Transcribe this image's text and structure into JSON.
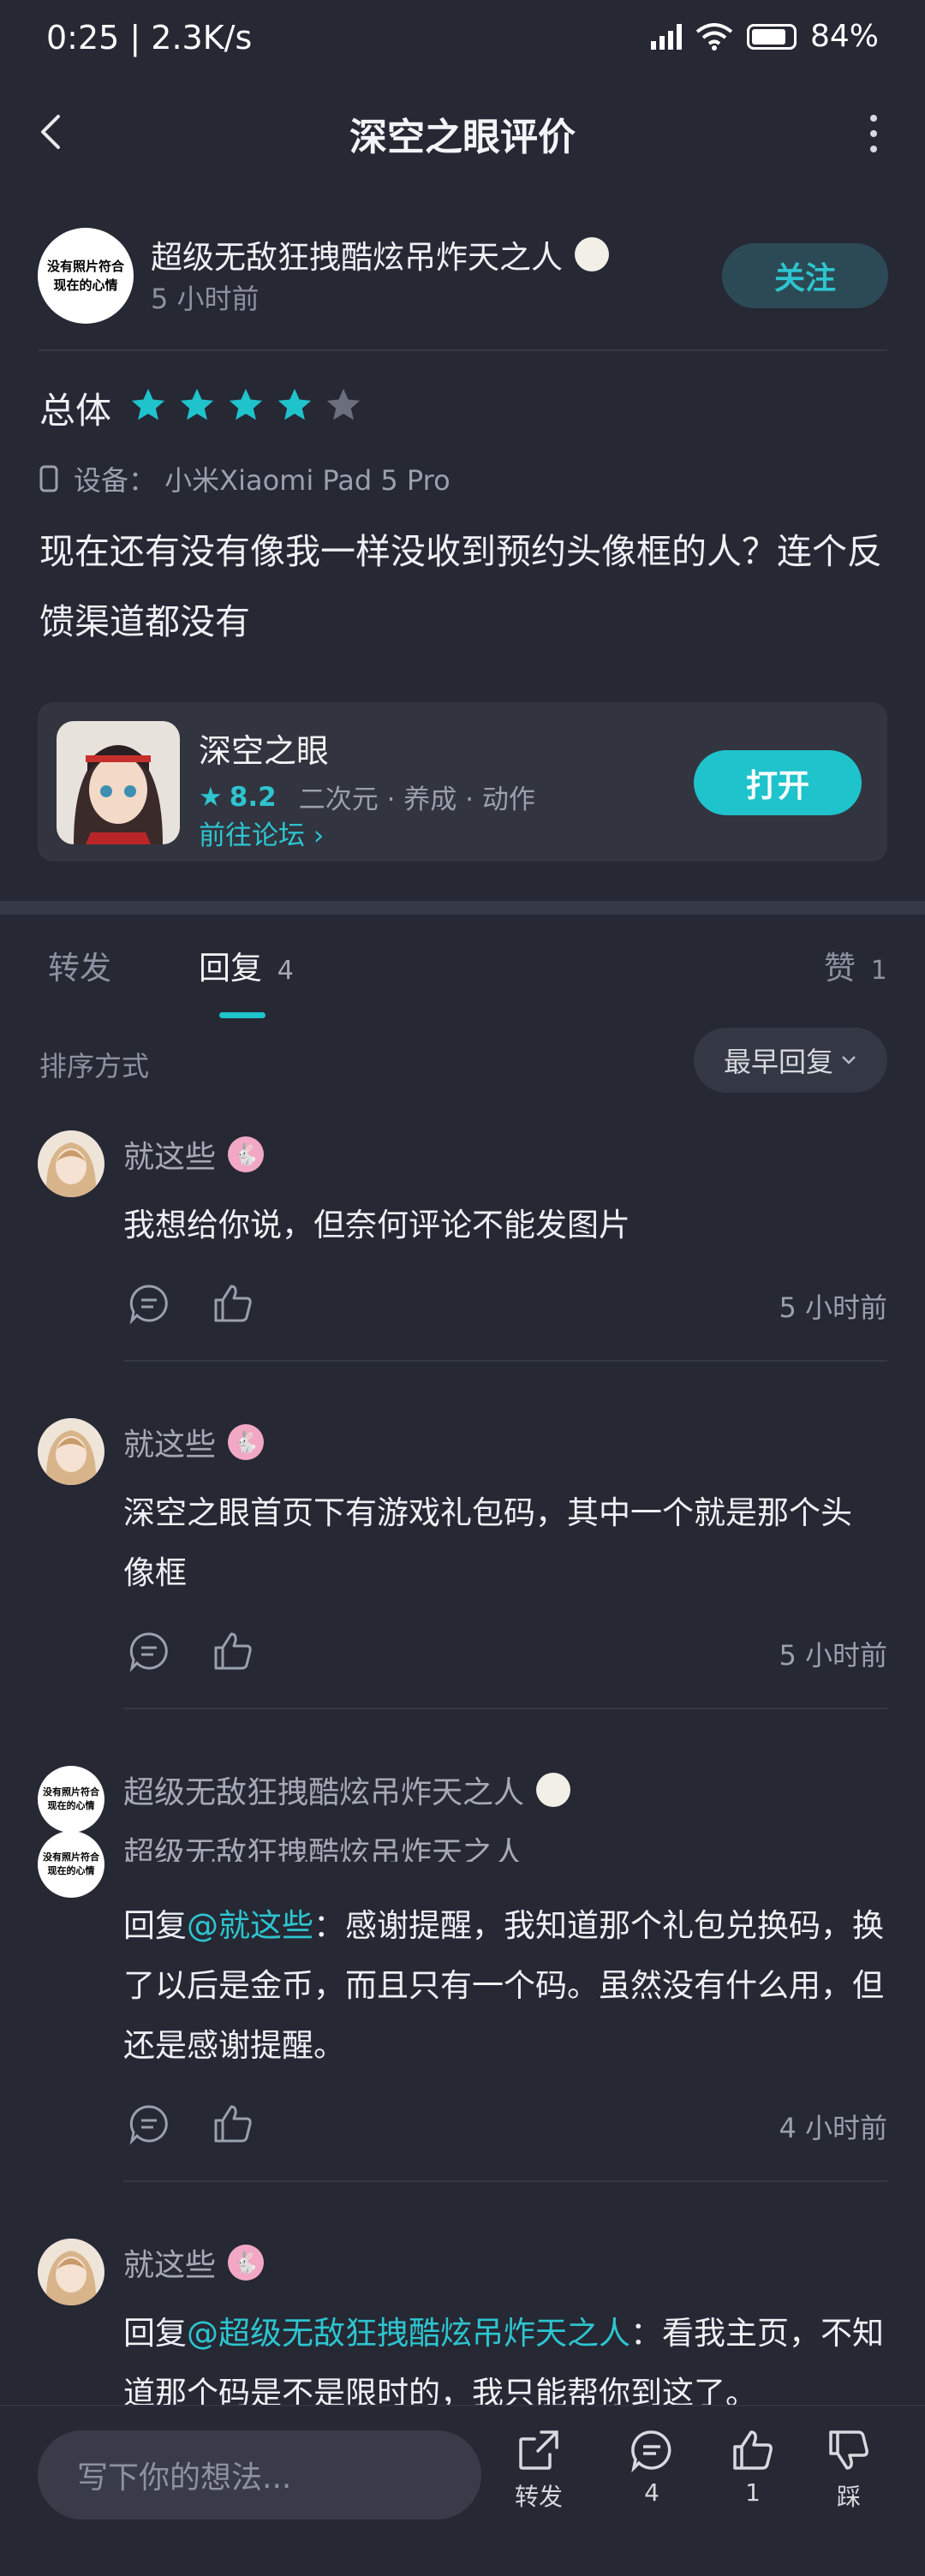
{
  "status_bar": {
    "time_speed": "0:25 | 2.3K/s",
    "battery": "84%"
  },
  "header": {
    "title": "深空之眼评价"
  },
  "author": {
    "avatar_text_line1": "没有照片符合",
    "avatar_text_line2": "现在的心情",
    "name": "超级无敌狂拽酷炫吊炸天之人",
    "time": "5 小时前",
    "follow_label": "关注"
  },
  "rating": {
    "label": "总体",
    "stars": 4,
    "max": 5
  },
  "device": {
    "text": "设备：  小米Xiaomi Pad 5 Pro"
  },
  "review": {
    "text": "现在还有没有像我一样没收到预约头像框的人？连个反馈渠道都没有"
  },
  "game": {
    "name": "深空之眼",
    "score": "8.2",
    "tags": "二次元 · 养成 · 动作",
    "forum_link": "前往论坛 ›",
    "open_label": "打开"
  },
  "tabs": {
    "repost": "转发",
    "reply": "回复",
    "reply_count": "4",
    "like": "赞",
    "like_count": "1"
  },
  "sort": {
    "label": "排序方式",
    "value": "最早回复"
  },
  "comments": [
    {
      "name": "就这些",
      "text": "我想给你说，但奈何评论不能发图片",
      "time": "5 小时前"
    },
    {
      "name": "就这些",
      "text": "深空之眼首页下有游戏礼包码，其中一个就是那个头像框",
      "time": "5 小时前"
    },
    {
      "name": "超级无敌狂拽酷炫吊炸天之人",
      "overlap_name": "超级无敌狂拽酷炫吊炸天之人",
      "reply_prefix": "回复",
      "reply_to": "@就这些",
      "text": "：感谢提醒，我知道那个礼包兑换码，换了以后是金币，而且只有一个码。虽然没有什么用，但还是感谢提醒。",
      "time": "4 小时前"
    },
    {
      "name": "就这些",
      "reply_prefix": "回复",
      "reply_to": "@超级无敌狂拽酷炫吊炸天之人",
      "text": "：看我主页，不知道那个码是不是限时的，我只能帮你到这了。"
    }
  ],
  "bottom_bar": {
    "input_placeholder": "写下你的想法...",
    "repost": "转发",
    "comments": "4",
    "likes": "1",
    "dislike": "踩"
  },
  "colors": {
    "background": "#262834",
    "accent": "#1fc3cc",
    "card": "#32343f"
  }
}
